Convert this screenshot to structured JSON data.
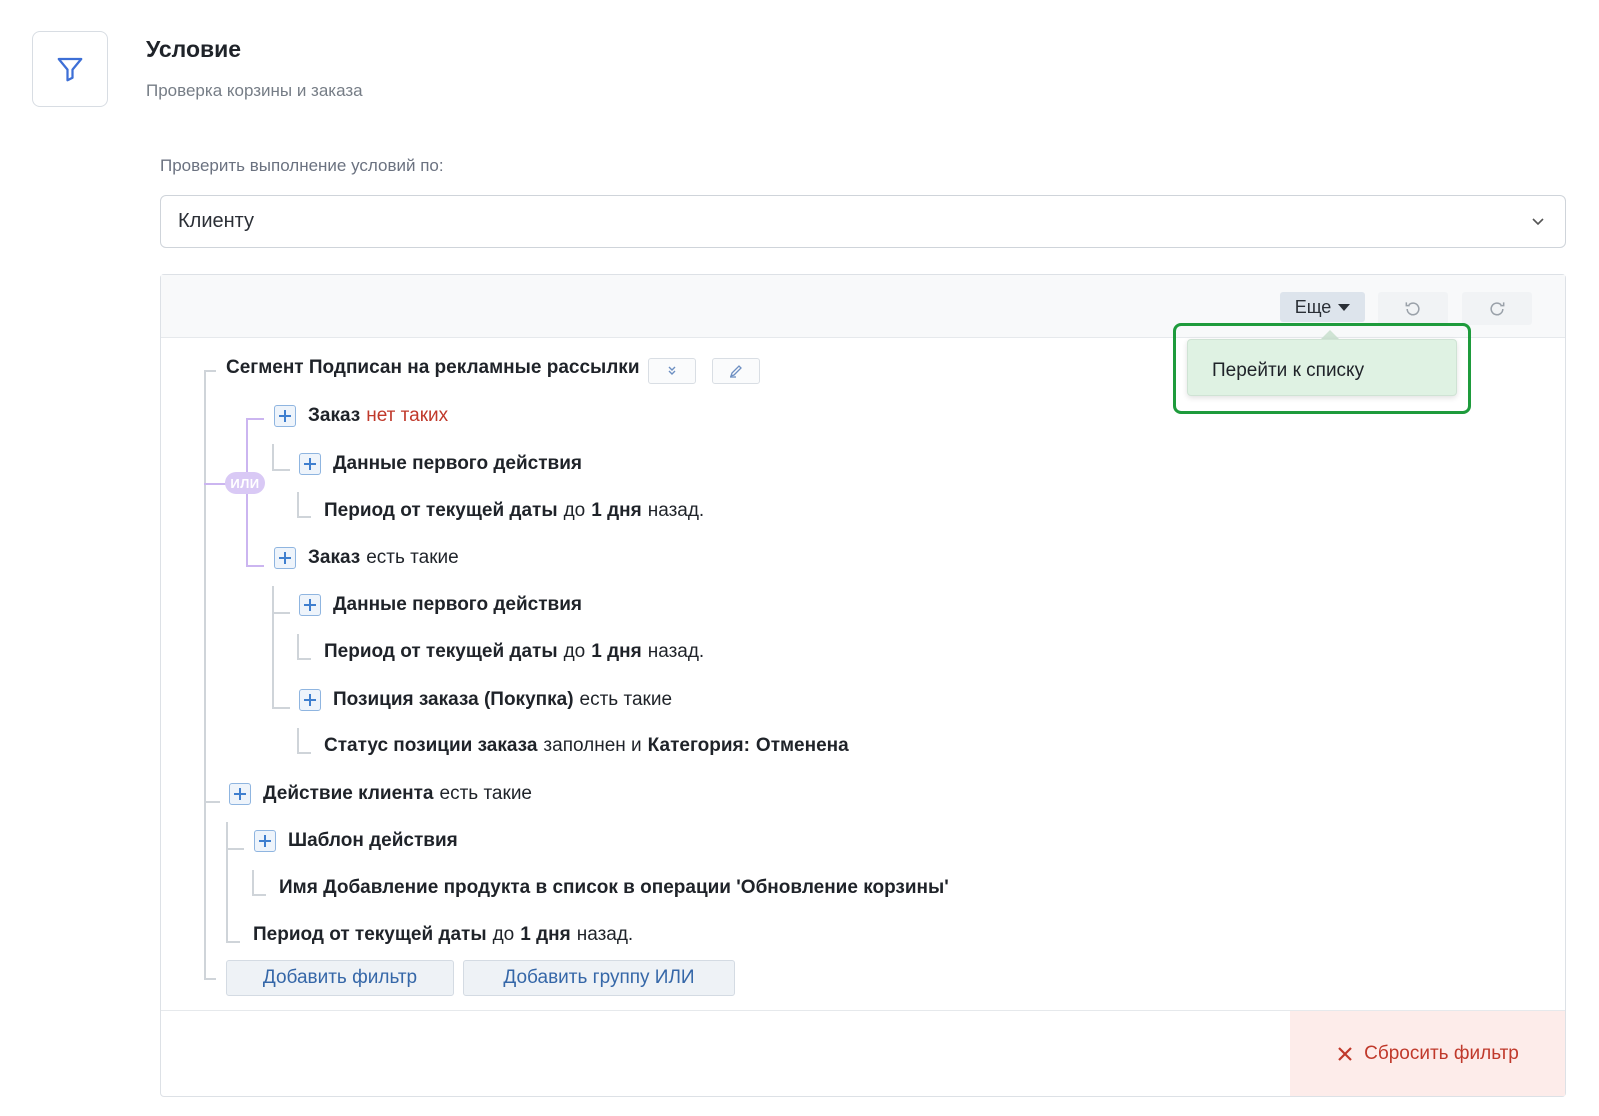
{
  "header": {
    "icon": "filter-icon",
    "title": "Условие",
    "subtitle": "Проверка корзины и заказа"
  },
  "check": {
    "label": "Проверить выполнение условий по:",
    "value": "Клиенту"
  },
  "toolbar": {
    "more_label": "Еще",
    "undo_icon": "undo-icon",
    "redo_icon": "redo-icon"
  },
  "dropdown": {
    "items": [
      "Перейти к списку"
    ]
  },
  "tree": {
    "segment": {
      "label": "Сегмент Подписан на рекламные рассылки"
    },
    "or_badge": "ИЛИ",
    "order1": {
      "label": "Заказ",
      "value": "нет таких"
    },
    "order1_first_action": "Данные первого действия",
    "order1_period": {
      "a": "Период от текущей даты",
      "b": "до",
      "c": "1 дня",
      "d": "назад."
    },
    "order2": {
      "label": "Заказ",
      "value": "есть такие"
    },
    "order2_first_action": "Данные первого действия",
    "order2_period": {
      "a": "Период от текущей даты",
      "b": "до",
      "c": "1 дня",
      "d": "назад."
    },
    "order_position": {
      "label": "Позиция заказа (Покупка)",
      "value": "есть такие"
    },
    "status": {
      "a": "Статус позиции заказа",
      "b": "заполнен и",
      "c": "Категория:",
      "d": "Отменена"
    },
    "client_action": {
      "label": "Действие клиента",
      "value": "есть такие"
    },
    "action_template": "Шаблон действия",
    "name_line": "Имя Добавление продукта в список в операции 'Обновление корзины'",
    "client_period": {
      "a": "Период от текущей даты",
      "b": "до",
      "c": "1 дня",
      "d": "назад."
    }
  },
  "buttons": {
    "add_filter": "Добавить фильтр",
    "add_or_group": "Добавить группу ИЛИ",
    "reset_filter": "Сбросить фильтр"
  }
}
